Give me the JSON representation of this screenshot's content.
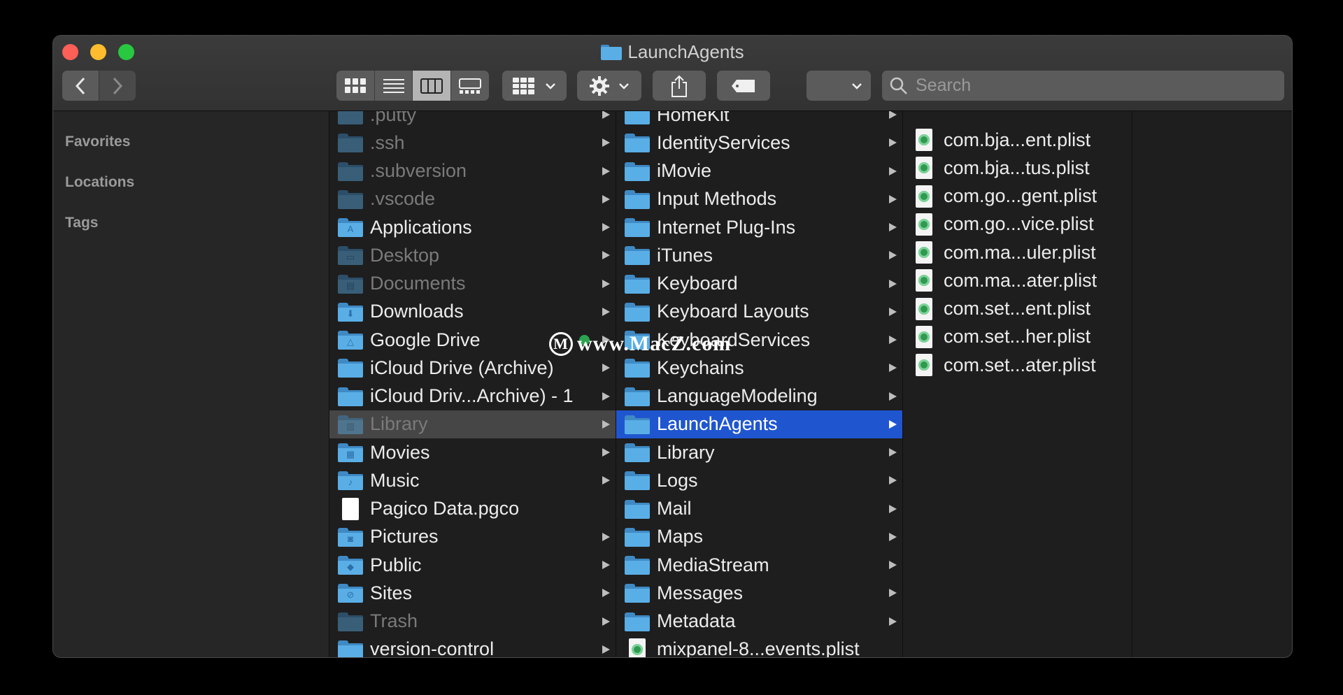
{
  "window": {
    "title": "LaunchAgents"
  },
  "toolbar": {
    "back_label": "‹",
    "forward_label": "›",
    "search_placeholder": "Search"
  },
  "sidebar": {
    "sections": [
      "Favorites",
      "Locations",
      "Tags"
    ]
  },
  "column1": [
    {
      "label": ".putty",
      "kind": "folder",
      "dim": true,
      "arrow": true
    },
    {
      "label": ".ssh",
      "kind": "folder",
      "dim": true,
      "arrow": true
    },
    {
      "label": ".subversion",
      "kind": "folder",
      "dim": true,
      "arrow": true
    },
    {
      "label": ".vscode",
      "kind": "folder",
      "dim": true,
      "arrow": true
    },
    {
      "label": "Applications",
      "kind": "folder",
      "glyph": "A",
      "arrow": true
    },
    {
      "label": "Desktop",
      "kind": "folder",
      "glyph": "▭",
      "dim": true,
      "arrow": true
    },
    {
      "label": "Documents",
      "kind": "folder",
      "glyph": "▤",
      "dim": true,
      "arrow": true
    },
    {
      "label": "Downloads",
      "kind": "folder",
      "glyph": "⬇",
      "arrow": true
    },
    {
      "label": "Google Drive",
      "kind": "folder",
      "glyph": "△",
      "arrow": true,
      "badge": true
    },
    {
      "label": "iCloud Drive (Archive)",
      "kind": "folder",
      "arrow": true
    },
    {
      "label": "iCloud Driv...Archive) - 1",
      "kind": "folder",
      "arrow": true
    },
    {
      "label": "Library",
      "kind": "folder",
      "glyph": "▥",
      "dim": true,
      "arrow": true,
      "selected": "gray"
    },
    {
      "label": "Movies",
      "kind": "folder",
      "glyph": "▦",
      "arrow": true
    },
    {
      "label": "Music",
      "kind": "folder",
      "glyph": "♪",
      "arrow": true
    },
    {
      "label": "Pagico Data.pgco",
      "kind": "doc",
      "arrow": false
    },
    {
      "label": "Pictures",
      "kind": "folder",
      "glyph": "◙",
      "arrow": true
    },
    {
      "label": "Public",
      "kind": "folder",
      "glyph": "◆",
      "arrow": true
    },
    {
      "label": "Sites",
      "kind": "folder",
      "glyph": "⊘",
      "arrow": true
    },
    {
      "label": "Trash",
      "kind": "folder",
      "dim": true,
      "arrow": true
    },
    {
      "label": "version-control",
      "kind": "folder",
      "arrow": true
    }
  ],
  "column2": [
    {
      "label": "HomeKit",
      "kind": "folder",
      "arrow": true
    },
    {
      "label": "IdentityServices",
      "kind": "folder",
      "arrow": true
    },
    {
      "label": "iMovie",
      "kind": "folder",
      "arrow": true
    },
    {
      "label": "Input Methods",
      "kind": "folder",
      "arrow": true
    },
    {
      "label": "Internet Plug-Ins",
      "kind": "folder",
      "arrow": true
    },
    {
      "label": "iTunes",
      "kind": "folder",
      "arrow": true
    },
    {
      "label": "Keyboard",
      "kind": "folder",
      "arrow": true
    },
    {
      "label": "Keyboard Layouts",
      "kind": "folder",
      "arrow": true
    },
    {
      "label": "KeyboardServices",
      "kind": "folder",
      "arrow": true
    },
    {
      "label": "Keychains",
      "kind": "folder",
      "arrow": true
    },
    {
      "label": "LanguageModeling",
      "kind": "folder",
      "arrow": true
    },
    {
      "label": "LaunchAgents",
      "kind": "folder",
      "arrow": true,
      "selected": "blue"
    },
    {
      "label": "Library",
      "kind": "folder",
      "arrow": true
    },
    {
      "label": "Logs",
      "kind": "folder",
      "arrow": true
    },
    {
      "label": "Mail",
      "kind": "folder",
      "arrow": true
    },
    {
      "label": "Maps",
      "kind": "folder",
      "arrow": true
    },
    {
      "label": "MediaStream",
      "kind": "folder",
      "arrow": true
    },
    {
      "label": "Messages",
      "kind": "folder",
      "arrow": true
    },
    {
      "label": "Metadata",
      "kind": "folder",
      "arrow": true
    },
    {
      "label": "mixpanel-8...events.plist",
      "kind": "plist",
      "arrow": false
    }
  ],
  "column3": [
    {
      "label": "com.bja...ent.plist",
      "kind": "plist"
    },
    {
      "label": "com.bja...tus.plist",
      "kind": "plist"
    },
    {
      "label": "com.go...gent.plist",
      "kind": "plist"
    },
    {
      "label": "com.go...vice.plist",
      "kind": "plist"
    },
    {
      "label": "com.ma...uler.plist",
      "kind": "plist"
    },
    {
      "label": "com.ma...ater.plist",
      "kind": "plist"
    },
    {
      "label": "com.set...ent.plist",
      "kind": "plist"
    },
    {
      "label": "com.set...her.plist",
      "kind": "plist"
    },
    {
      "label": "com.set...ater.plist",
      "kind": "plist"
    }
  ],
  "watermark": {
    "mark": "M",
    "text": "www.MacZ.com"
  },
  "icons": {
    "view_icons": "grid-icon",
    "view_list": "list-icon",
    "view_columns": "columns-icon",
    "view_gallery": "gallery-icon",
    "group": "group-icon",
    "action": "gear-icon",
    "share": "share-icon",
    "tag": "tag-icon"
  },
  "colors": {
    "selection": "#1f56d0",
    "folder": "#5aaee6",
    "close": "#fe5f57",
    "minimize": "#febc2e",
    "zoom": "#28c840"
  }
}
